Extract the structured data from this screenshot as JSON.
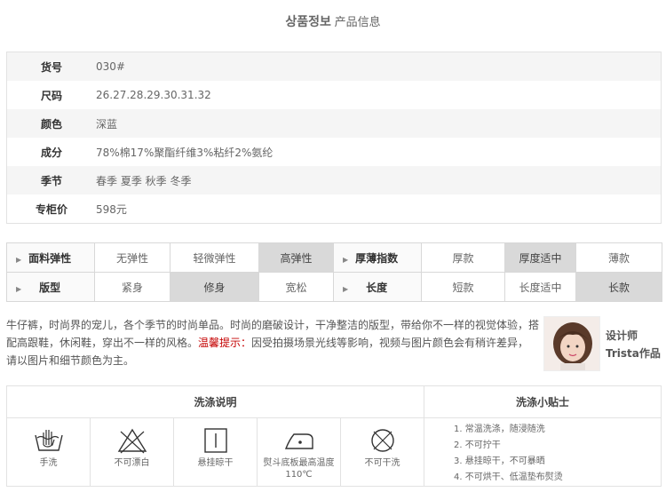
{
  "title": {
    "ko": "상품정보",
    "zh": "产品信息"
  },
  "info": [
    {
      "key": "货号",
      "value": "030#"
    },
    {
      "key": "尺码",
      "value": "26.27.28.29.30.31.32"
    },
    {
      "key": "颜色",
      "value": "深蓝"
    },
    {
      "key": "成分",
      "value": "78%棉17%聚酯纤维3%粘纤2%氨纶"
    },
    {
      "key": "季节",
      "value": "春季 夏季 秋季 冬季"
    },
    {
      "key": "专柜价",
      "value": "598元"
    }
  ],
  "attributes": {
    "row1": {
      "label_a": "面料弹性",
      "opts_a": [
        "无弹性",
        "轻微弹性",
        "高弹性"
      ],
      "label_b": "厚薄指数",
      "opts_b": [
        "厚款",
        "厚度适中",
        "薄款"
      ]
    },
    "row2": {
      "label_a": "版型",
      "opts_a": [
        "紧身",
        "修身",
        "宽松"
      ],
      "label_b": "长度",
      "opts_b": [
        "短款",
        "长度适中",
        "长款"
      ]
    },
    "selected": {
      "面料弹性": "高弹性",
      "厚薄指数": "厚度适中",
      "版型": "修身",
      "长度": "长款"
    }
  },
  "description": {
    "text1": "牛仔裤，时尚界的宠儿，各个季节的时尚单品。时尚的磨破设计，干净整洁的版型，带给你不一样的视觉体验，搭配高跟鞋，休闲鞋，穿出不一样的风格。",
    "warning": "温馨提示：",
    "text2": "因受拍摄场景光线等影响，视频与图片颜色会有稍许差异，请以图片和细节颜色为主。"
  },
  "designer": {
    "line1": "设计师",
    "line2": "Trista作品"
  },
  "wash": {
    "header_left": "洗涤说明",
    "header_right": "洗涤小贴士",
    "icons": [
      {
        "icon": "hand-wash-icon",
        "label": "手洗"
      },
      {
        "icon": "no-bleach-icon",
        "label": "不可漂白"
      },
      {
        "icon": "hang-dry-icon",
        "label": "悬挂晾干"
      },
      {
        "icon": "iron-icon",
        "label": "熨斗底板最高温度110℃"
      },
      {
        "icon": "no-dry-clean-icon",
        "label": "不可干洗"
      }
    ],
    "tips": [
      "1. 常温洗涤，随浸随洗",
      "2. 不可拧干",
      "3. 悬挂晾干，不可暴晒",
      "4. 不可烘干、低温垫布熨烫"
    ]
  }
}
